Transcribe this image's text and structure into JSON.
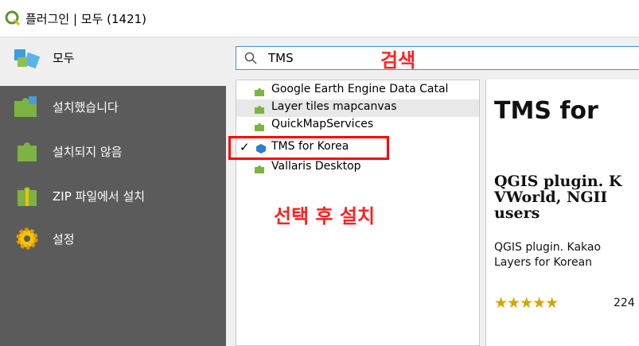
{
  "window": {
    "title": "플러그인 | 모두 (1421)"
  },
  "sidebar": {
    "items": [
      {
        "label": "모두",
        "icon": "all-plugins-icon"
      },
      {
        "label": "설치했습니다",
        "icon": "installed-plugin-icon"
      },
      {
        "label": "설치되지 않음",
        "icon": "not-installed-plugin-icon"
      },
      {
        "label": "ZIP 파일에서 설치",
        "icon": "zip-install-icon"
      },
      {
        "label": "설정",
        "icon": "gear-icon"
      }
    ]
  },
  "search": {
    "value": "TMS"
  },
  "plugins": {
    "items": [
      {
        "label": "Google Earth Engine Data Catal"
      },
      {
        "label": "Layer tiles mapcanvas"
      },
      {
        "label": "QuickMapServices"
      },
      {
        "label": "TMS for Korea",
        "checked": true
      },
      {
        "label": "Vallaris Desktop"
      }
    ]
  },
  "details": {
    "title": "TMS for",
    "subtitle_lines": [
      "QGIS plugin. K",
      "VWorld, NGII",
      "users"
    ],
    "description_lines": [
      "QGIS plugin. Kakao",
      "Layers for Korean"
    ],
    "stars": "★★★★★",
    "votes": "224"
  },
  "annotations": {
    "search": "검색",
    "install": "선택 후 설치"
  },
  "colors": {
    "accent": "#4a8dd8",
    "annotation": "#ff0000",
    "sidebar_dark": "#5b5b5b"
  }
}
